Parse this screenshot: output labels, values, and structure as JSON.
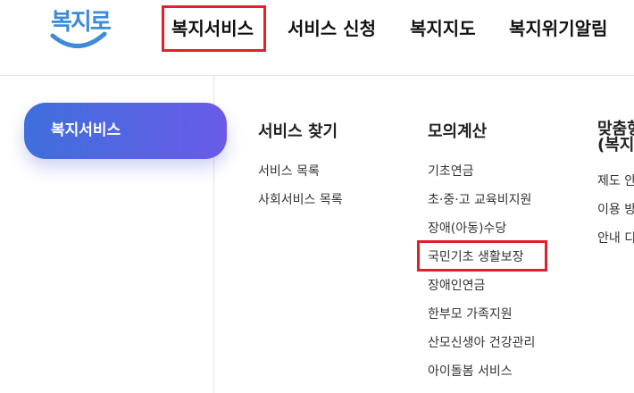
{
  "logo": {
    "text": "복지로"
  },
  "gnb": {
    "items": [
      {
        "label": "복지서비스"
      },
      {
        "label": "서비스 신청"
      },
      {
        "label": "복지지도"
      },
      {
        "label": "복지위기알림"
      }
    ]
  },
  "megamenu": {
    "side_label": "복지서비스",
    "columns": [
      {
        "title": "서비스 찾기",
        "items": [
          "서비스 목록",
          "사회서비스 목록"
        ]
      },
      {
        "title": "모의계산",
        "items": [
          "기초연금",
          "초·중·고 교육비지원",
          "장애(아동)수당",
          "국민기초 생활보장",
          "장애인연금",
          "한부모 가족지원",
          "산모신생아 건강관리",
          "아이돌봄 서비스"
        ]
      },
      {
        "title_line1": "맞춤형",
        "title_line2": "(복지",
        "items": [
          "제도 안",
          "이용 방",
          "안내 디"
        ]
      }
    ]
  },
  "colors": {
    "accent_gradient_start": "#3f6fdc",
    "accent_gradient_end": "#6a5ae8",
    "highlight_box": "#e0202c",
    "logo_blue": "#3d8bd9"
  }
}
